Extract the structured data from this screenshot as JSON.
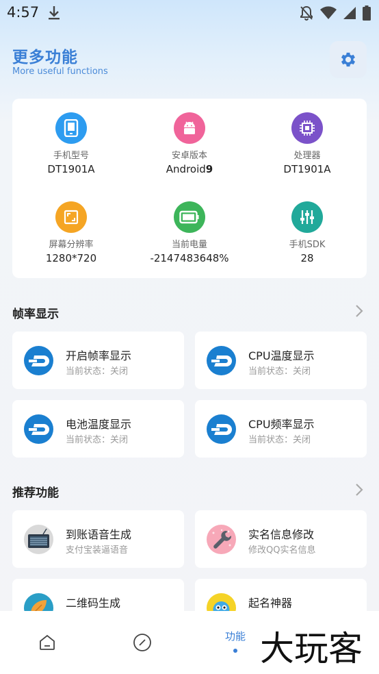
{
  "status_bar": {
    "time": "4:57"
  },
  "header": {
    "title": "更多功能",
    "subtitle": "More useful functions",
    "settings_icon": "gear-icon"
  },
  "device_info": [
    {
      "label": "手机型号",
      "value": "DT1901A",
      "icon": "tablet-icon",
      "color": "#2d9cf0"
    },
    {
      "label": "安卓版本",
      "value": "Android",
      "value_suffix": "9",
      "icon": "android-icon",
      "color": "#f0649a"
    },
    {
      "label": "处理器",
      "value": "DT1901A",
      "icon": "chip-icon",
      "color": "#7b52c9"
    },
    {
      "label": "屏幕分辨率",
      "value": "1280*720",
      "icon": "screen-icon",
      "color": "#f5a524"
    },
    {
      "label": "当前电量",
      "value": "-2147483648%",
      "icon": "battery-icon",
      "color": "#3db55a"
    },
    {
      "label": "手机SDK",
      "value": "28",
      "icon": "sliders-icon",
      "color": "#21a99a"
    }
  ],
  "fps_section": {
    "title": "帧率显示",
    "items": [
      {
        "title": "开启帧率显示",
        "status": "当前状态：关闭"
      },
      {
        "title": "CPU温度显示",
        "status": "当前状态：关闭"
      },
      {
        "title": "电池温度显示",
        "status": "当前状态：关闭"
      },
      {
        "title": "CPU频率显示",
        "status": "当前状态：关闭"
      }
    ]
  },
  "recommend_section": {
    "title": "推荐功能",
    "items": [
      {
        "title": "到账语音生成",
        "subtitle": "支付宝装逼语音"
      },
      {
        "title": "实名信息修改",
        "subtitle": "修改QQ实名信息"
      },
      {
        "title": "二维码生成",
        "subtitle": ""
      },
      {
        "title": "起名神器",
        "subtitle": ""
      }
    ]
  },
  "bottom_nav": {
    "active_label": "功能",
    "accent": "#3a7fd6"
  },
  "watermark_text": "大玩客"
}
